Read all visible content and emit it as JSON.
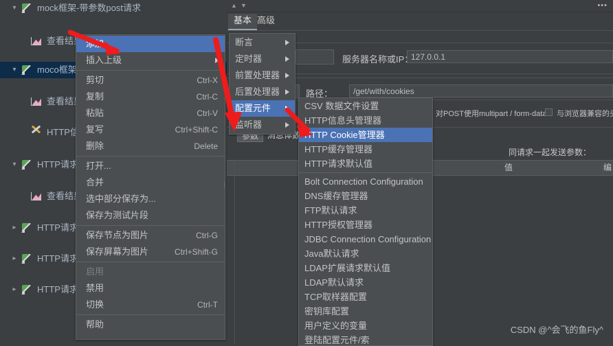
{
  "app": {
    "colors": {
      "bg": "#3c3f41",
      "menu_bg": "#4a4e50",
      "highlight": "#4a72b5",
      "tree_selected": "#0d2c49",
      "arrow_red": "#ee1c1c",
      "text": "#c4c4c4"
    }
  },
  "tree": {
    "items": [
      {
        "label": "mock框架-带参数post请求",
        "icon": "pencil-icon",
        "indent": 1,
        "twisty": "expanded",
        "selected": false
      },
      {
        "label": "查看结果树",
        "icon": "result-tree-icon",
        "indent": 2,
        "twisty": "none",
        "selected": false
      },
      {
        "label": "moco框架加入cookie的GET请求",
        "icon": "pencil-icon",
        "indent": 1,
        "twisty": "expanded",
        "selected": true
      },
      {
        "label": "查看结果树",
        "icon": "result-tree-icon",
        "indent": 2,
        "twisty": "none",
        "selected": false
      },
      {
        "label": "HTTP信息头管理器",
        "icon": "tool-icon",
        "indent": 2,
        "twisty": "none",
        "selected": false
      },
      {
        "label": "HTTP请求",
        "icon": "pencil-icon",
        "indent": 1,
        "twisty": "expanded",
        "selected": false
      },
      {
        "label": "查看结果树",
        "icon": "result-tree-icon",
        "indent": 2,
        "twisty": "none",
        "selected": false
      },
      {
        "label": "HTTP请求",
        "icon": "pencil-icon",
        "indent": 1,
        "twisty": "collapsed",
        "selected": false
      },
      {
        "label": "HTTP请求",
        "icon": "pencil-icon",
        "indent": 1,
        "twisty": "collapsed",
        "selected": false
      },
      {
        "label": "HTTP请求",
        "icon": "pencil-icon",
        "indent": 1,
        "twisty": "collapsed",
        "selected": false
      }
    ]
  },
  "context_menu": {
    "items": [
      {
        "label": "添加",
        "shortcut": "",
        "submenu": true,
        "highlighted": true,
        "disabled": false
      },
      {
        "label": "插入上级",
        "shortcut": "",
        "submenu": true,
        "highlighted": false,
        "disabled": false
      },
      {
        "separator_after": true,
        "label": "",
        "shortcut": "",
        "submenu": false,
        "highlighted": false,
        "disabled": false
      },
      {
        "label": "剪切",
        "shortcut": "Ctrl-X",
        "submenu": false,
        "highlighted": false,
        "disabled": false
      },
      {
        "label": "复制",
        "shortcut": "Ctrl-C",
        "submenu": false,
        "highlighted": false,
        "disabled": false
      },
      {
        "label": "粘贴",
        "shortcut": "Ctrl-V",
        "submenu": false,
        "highlighted": false,
        "disabled": false
      },
      {
        "label": "复写",
        "shortcut": "Ctrl+Shift-C",
        "submenu": false,
        "highlighted": false,
        "disabled": false
      },
      {
        "label": "删除",
        "shortcut": "Delete",
        "submenu": false,
        "highlighted": false,
        "disabled": false
      },
      {
        "label": "打开...",
        "shortcut": "",
        "submenu": false,
        "highlighted": false,
        "disabled": false
      },
      {
        "label": "合并",
        "shortcut": "",
        "submenu": false,
        "highlighted": false,
        "disabled": false
      },
      {
        "label": "选中部分保存为...",
        "shortcut": "",
        "submenu": false,
        "highlighted": false,
        "disabled": false
      },
      {
        "label": "保存为测试片段",
        "shortcut": "",
        "submenu": false,
        "highlighted": false,
        "disabled": false
      },
      {
        "label": "保存节点为图片",
        "shortcut": "Ctrl-G",
        "submenu": false,
        "highlighted": false,
        "disabled": false
      },
      {
        "label": "保存屏幕为图片",
        "shortcut": "Ctrl+Shift-G",
        "submenu": false,
        "highlighted": false,
        "disabled": false
      },
      {
        "label": "启用",
        "shortcut": "",
        "submenu": false,
        "highlighted": false,
        "disabled": true
      },
      {
        "label": "禁用",
        "shortcut": "",
        "submenu": false,
        "highlighted": false,
        "disabled": false
      },
      {
        "label": "切换",
        "shortcut": "Ctrl-T",
        "submenu": false,
        "highlighted": false,
        "disabled": false
      },
      {
        "label": "帮助",
        "shortcut": "",
        "submenu": false,
        "highlighted": false,
        "disabled": false
      }
    ]
  },
  "submenu_add": {
    "items": [
      {
        "label": "断言",
        "submenu": true,
        "highlighted": false
      },
      {
        "label": "定时器",
        "submenu": true,
        "highlighted": false
      },
      {
        "label": "前置处理器",
        "submenu": true,
        "highlighted": false
      },
      {
        "label": "后置处理器",
        "submenu": true,
        "highlighted": false
      },
      {
        "label": "配置元件",
        "submenu": true,
        "highlighted": true
      },
      {
        "label": "监听器",
        "submenu": true,
        "highlighted": false
      }
    ]
  },
  "submenu_config": {
    "items": [
      {
        "label": "CSV 数据文件设置",
        "highlighted": false
      },
      {
        "label": "HTTP信息头管理器",
        "highlighted": false
      },
      {
        "label": "HTTP Cookie管理器",
        "highlighted": true
      },
      {
        "label": "HTTP缓存管理器",
        "highlighted": false
      },
      {
        "label": "HTTP请求默认值",
        "highlighted": false
      },
      {
        "label": "Bolt Connection Configuration",
        "highlighted": false
      },
      {
        "label": "DNS缓存管理器",
        "highlighted": false
      },
      {
        "label": "FTP默认请求",
        "highlighted": false
      },
      {
        "label": "HTTP授权管理器",
        "highlighted": false
      },
      {
        "label": "JDBC Connection Configuration",
        "highlighted": false
      },
      {
        "label": "Java默认请求",
        "highlighted": false
      },
      {
        "label": "LDAP扩展请求默认值",
        "highlighted": false
      },
      {
        "label": "LDAP默认请求",
        "highlighted": false
      },
      {
        "label": "TCP取样器配置",
        "highlighted": false
      },
      {
        "label": "密钥库配置",
        "highlighted": false
      },
      {
        "label": "用户定义的变量",
        "highlighted": false
      },
      {
        "label": "登陆配置元件/索",
        "highlighted": false
      }
    ]
  },
  "right_panel": {
    "tabs": [
      {
        "label": "基本",
        "active": true
      },
      {
        "label": "高级",
        "active": false
      }
    ],
    "toolbar": {
      "up_icon": "arrow-up-icon",
      "down_icon": "arrow-down-icon",
      "more_icon": "more-options-icon",
      "more_label": "•••"
    },
    "server_label": "服务器名称或IP：",
    "server_value": "127.0.0.1",
    "path_label": "路径：",
    "path_value": "/get/with/cookies",
    "checkbox_multipart": {
      "label": "对POST使用multipart / form-data",
      "checked": false
    },
    "checkbox_browser": {
      "label": "与浏览器兼容的头",
      "checked": false
    },
    "send_params_label": "同请求一起发送参数：",
    "table_headers": [
      "值",
      "编"
    ],
    "sub_tabs": [
      {
        "label": "参数",
        "selected": true
      },
      {
        "label": "消息体数据",
        "selected": false
      }
    ]
  },
  "watermark": "CSDN @^会飞的鱼Fly^"
}
